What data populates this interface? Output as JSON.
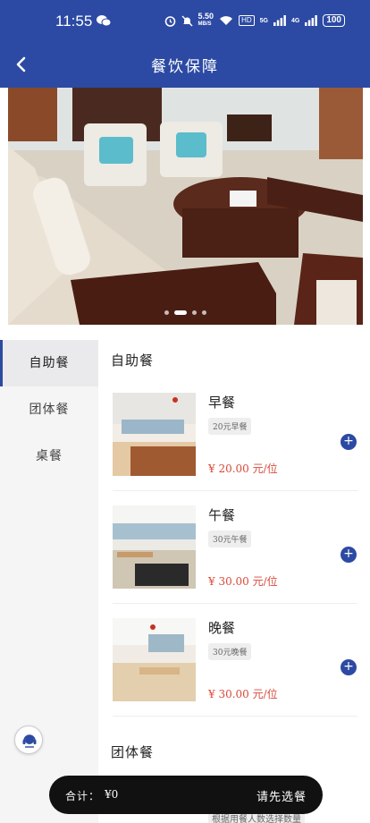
{
  "status_bar": {
    "time": "11:55",
    "speed_value": "5.50",
    "speed_unit": "MB/S",
    "hd_label": "HD",
    "signal1": "5G",
    "signal2": "4G",
    "battery": "100",
    "icons": [
      "wechat-icon",
      "alarm-icon",
      "mute-icon",
      "wifi-icon",
      "signal-icon"
    ]
  },
  "header": {
    "title": "餐饮保障",
    "back_icon": "chevron-left-icon"
  },
  "banner": {
    "slides": 4,
    "active_index": 1
  },
  "sidebar": {
    "items": [
      {
        "label": "自助餐",
        "active": true
      },
      {
        "label": "团体餐",
        "active": false
      },
      {
        "label": "桌餐",
        "active": false
      }
    ]
  },
  "content": {
    "section1_title": "自助餐",
    "section2_title": "团体餐",
    "meals": [
      {
        "name": "早餐",
        "tag": "20元早餐",
        "price": "¥ 20.00 元/位"
      },
      {
        "name": "午餐",
        "tag": "30元午餐",
        "price": "¥ 30.00 元/位"
      },
      {
        "name": "晚餐",
        "tag": "30元晚餐",
        "price": "¥ 30.00 元/位"
      }
    ],
    "add_symbol": "+",
    "hint": "根据用餐人数选择数量"
  },
  "cart": {
    "label": "合计：",
    "amount": "¥0",
    "action": "请先选餐"
  },
  "colors": {
    "primary": "#2c4aa3",
    "price": "#d84a3a",
    "cart_bg": "#111111"
  }
}
